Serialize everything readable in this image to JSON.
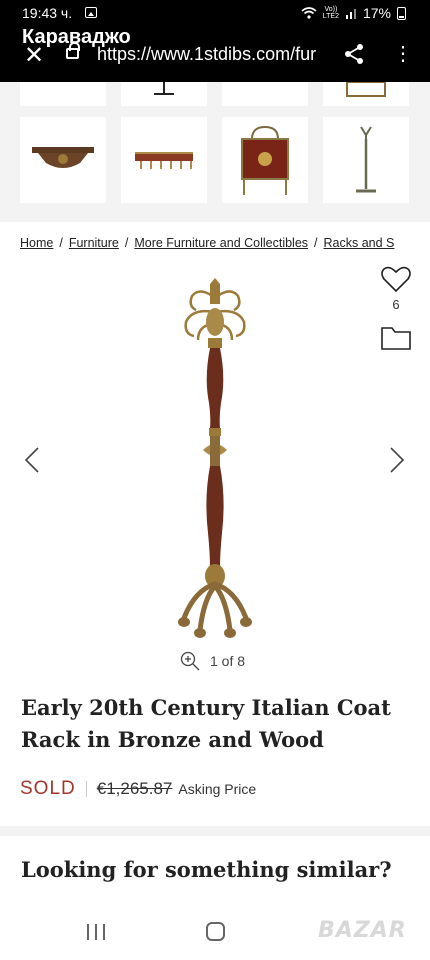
{
  "status_bar": {
    "time": "19:43 ч.",
    "network_top": "Vo))",
    "network_bottom": "LTE2",
    "battery": "17%"
  },
  "browser": {
    "site_title": "Караваджо",
    "url": "https://www.1stdibs.com/fur"
  },
  "breadcrumb": {
    "items": [
      "Home",
      "Furniture",
      "More Furniture and Collectibles",
      "Racks and S"
    ],
    "separator": "/"
  },
  "favorites": {
    "count": "6"
  },
  "gallery": {
    "counter": "1 of 8"
  },
  "product": {
    "title": "Early 20th Century Italian Coat Rack in Bronze and Wood",
    "status": "SOLD",
    "price": "€1,265.87",
    "price_label": "Asking Price"
  },
  "similar": {
    "heading": "Looking for something similar?"
  },
  "watermark": "BAZAR",
  "colors": {
    "sold": "#a1362c",
    "wood": "#6b2e1c",
    "brass": "#9c7a3a"
  },
  "icons": [
    "picture-icon",
    "close-icon",
    "lock-icon",
    "share-icon",
    "overflow-menu-icon",
    "heart-icon",
    "folder-icon",
    "chevron-left-icon",
    "chevron-right-icon",
    "zoom-icon",
    "recent-apps-icon",
    "home-icon"
  ]
}
